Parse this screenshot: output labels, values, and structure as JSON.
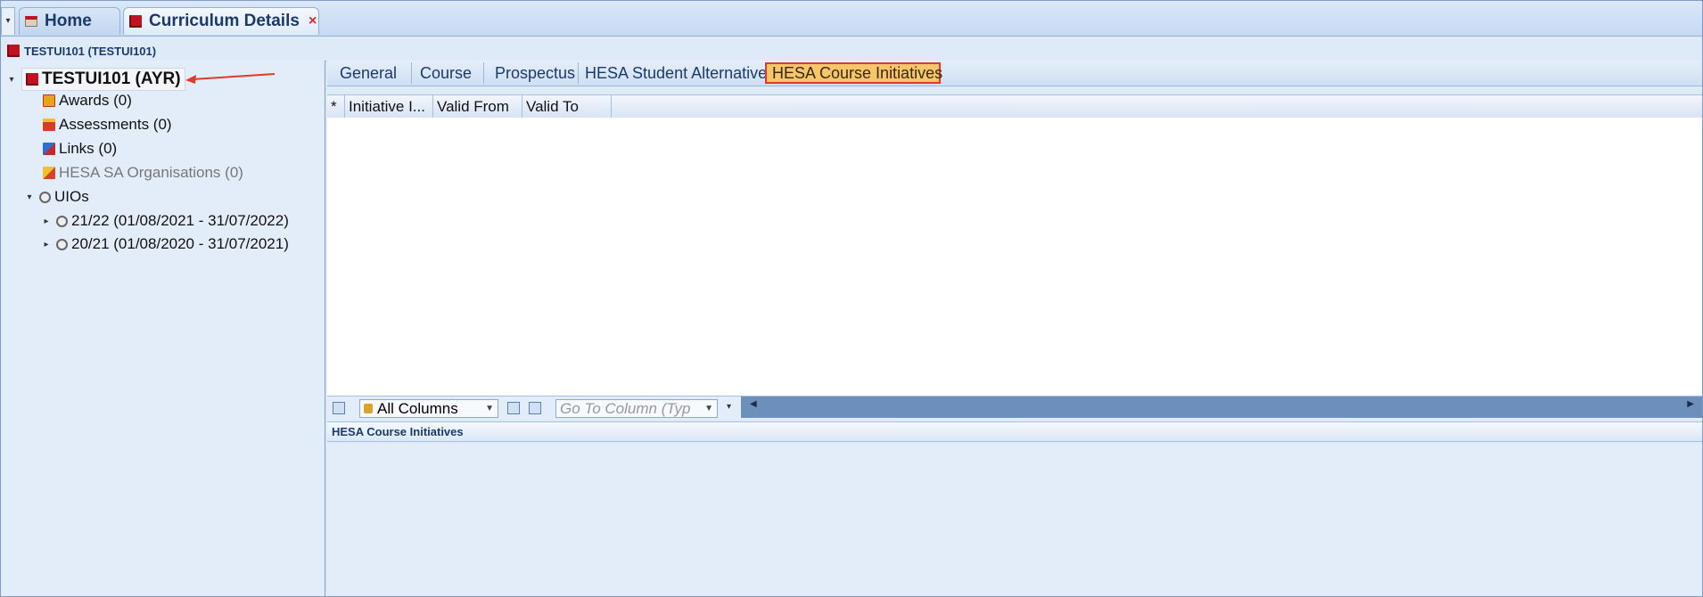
{
  "doc_tabs": {
    "home_label": "Home",
    "active_label": "Curriculum Details",
    "close_glyph": "×"
  },
  "breadcrumb": "TESTUI101 (TESTUI101)",
  "tree": {
    "root_label": "TESTUI101 (AYR)",
    "items": [
      {
        "label": "Awards (0)",
        "icon": "award-icon"
      },
      {
        "label": "Assessments (0)",
        "icon": "assessment-icon"
      },
      {
        "label": "Links (0)",
        "icon": "links-icon"
      },
      {
        "label": "HESA SA Organisations (0)",
        "icon": "organisation-icon"
      }
    ],
    "uios_label": "UIOs",
    "uio_children": [
      {
        "label": "21/22 (01/08/2021 - 31/07/2022)"
      },
      {
        "label": "20/21 (01/08/2020 - 31/07/2021)"
      }
    ]
  },
  "subtabs": [
    "General",
    "Course",
    "Prospectus",
    "HESA Student Alternative",
    "HESA Course Initiatives"
  ],
  "grid": {
    "columns": [
      "*",
      "Initiative I...",
      "Valid From",
      "Valid To"
    ]
  },
  "toolbar": {
    "column_select": "All Columns",
    "goto_placeholder": "Go To Column (Typ"
  },
  "detail_header": "HESA Course Initiatives",
  "colors": {
    "highlight_fill": "#f7c66a",
    "highlight_border": "#e03a2a",
    "annotation_arrow": "#e03a2a"
  }
}
